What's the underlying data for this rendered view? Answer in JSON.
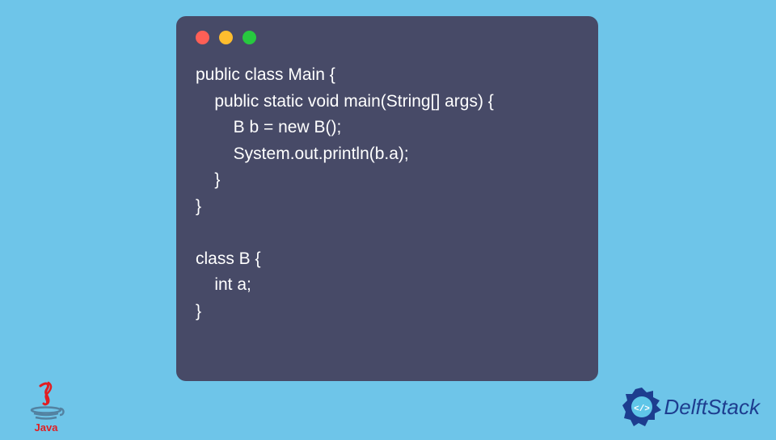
{
  "code": {
    "lines": [
      "public class Main {",
      "    public static void main(String[] args) {",
      "        B b = new B();",
      "        System.out.println(b.a);",
      "    }",
      "}",
      "",
      "class B {",
      "    int a;",
      "}"
    ]
  },
  "logos": {
    "java_label": "Java",
    "delft_label": "DelftStack"
  },
  "colors": {
    "background": "#6ec5e9",
    "code_bg": "#474a67",
    "code_text": "#ffffff",
    "dot_red": "#ff5f56",
    "dot_yellow": "#ffbd2e",
    "dot_green": "#27c93f",
    "java_red": "#e11e22",
    "java_blue": "#5382a1",
    "delft_blue": "#1d3d8f"
  }
}
